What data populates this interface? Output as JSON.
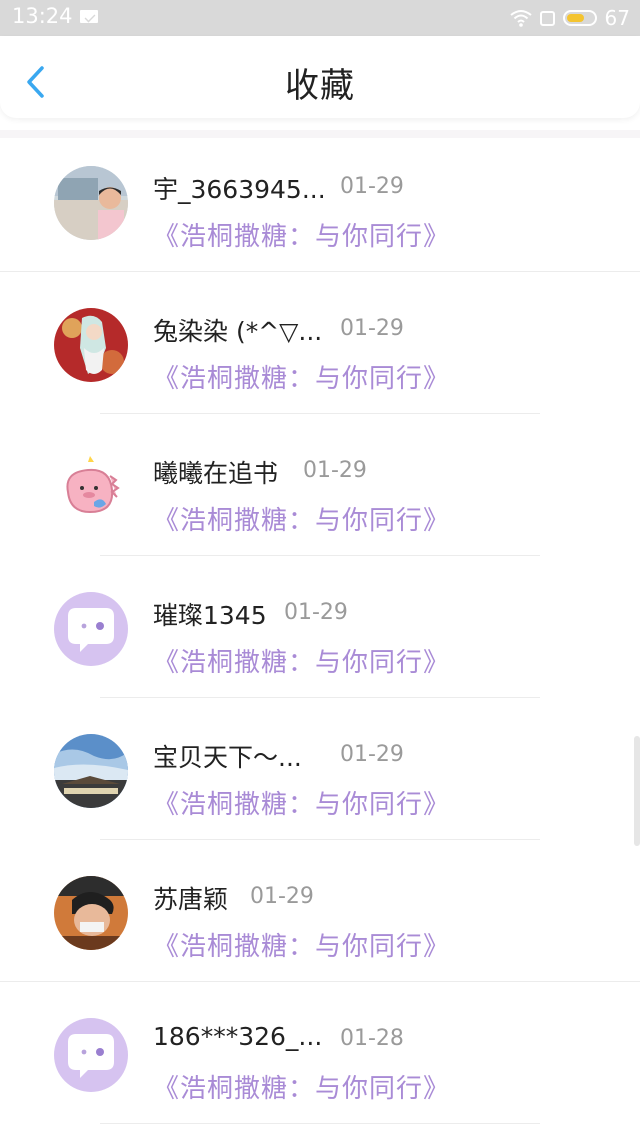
{
  "status_bar": {
    "time": "13:24",
    "battery": "67",
    "battery_level": 0.67,
    "icons": [
      "mail-icon",
      "wifi-icon",
      "screen-icon",
      "battery-icon"
    ]
  },
  "header": {
    "title": "收藏",
    "back_icon": "chevron-left-icon",
    "accent_color": "#3aa8f0"
  },
  "colors": {
    "book_title": "#a98bd6",
    "date": "#9a9a9a",
    "name": "#222222",
    "status_bar_bg": "#d9d9d9"
  },
  "favorites": [
    {
      "name": "宇_3663945...",
      "date": "01-29",
      "book": "《浩桐撒糖：与你同行》",
      "avatar": "photo-avatar-man"
    },
    {
      "name": "兔染染 (*^▽...",
      "date": "01-29",
      "book": "《浩桐撒糖：与你同行》",
      "avatar": "anime-avatar"
    },
    {
      "name": "曦曦在追书",
      "date": "01-29",
      "book": "《浩桐撒糖：与你同行》",
      "avatar": "pink-dino-avatar"
    },
    {
      "name": "璀璨1345",
      "date": "01-29",
      "book": "《浩桐撒糖：与你同行》",
      "avatar": "default-chat-avatar"
    },
    {
      "name": "宝贝天下～...",
      "date": "01-29",
      "book": "《浩桐撒糖：与你同行》",
      "avatar": "sky-photo-avatar"
    },
    {
      "name": "苏唐颖",
      "date": "01-29",
      "book": "《浩桐撒糖：与你同行》",
      "avatar": "child-photo-avatar"
    },
    {
      "name": "186***326_...",
      "date": "01-28",
      "book": "《浩桐撒糖：与你同行》",
      "avatar": "default-chat-avatar"
    }
  ]
}
